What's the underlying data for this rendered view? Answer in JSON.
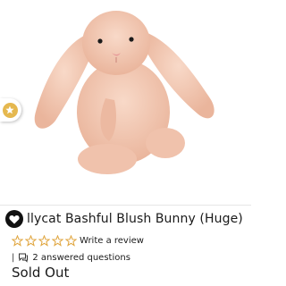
{
  "product": {
    "title": "llycat Bashful Blush Bunny (Huge)",
    "rating_stars": 0,
    "review_link": "Write a review",
    "questions_link": "2 answered questions",
    "stock_status": "Sold Out"
  },
  "icons": {
    "wishlist": "heart-icon",
    "rewards": "star-coin-icon",
    "rating": "star-outline-icon",
    "questions": "chat-bubble-icon"
  },
  "colors": {
    "bunny": "#f2c9b4",
    "star_outline": "#e0a640",
    "reward_coin": "#e5b84f"
  }
}
